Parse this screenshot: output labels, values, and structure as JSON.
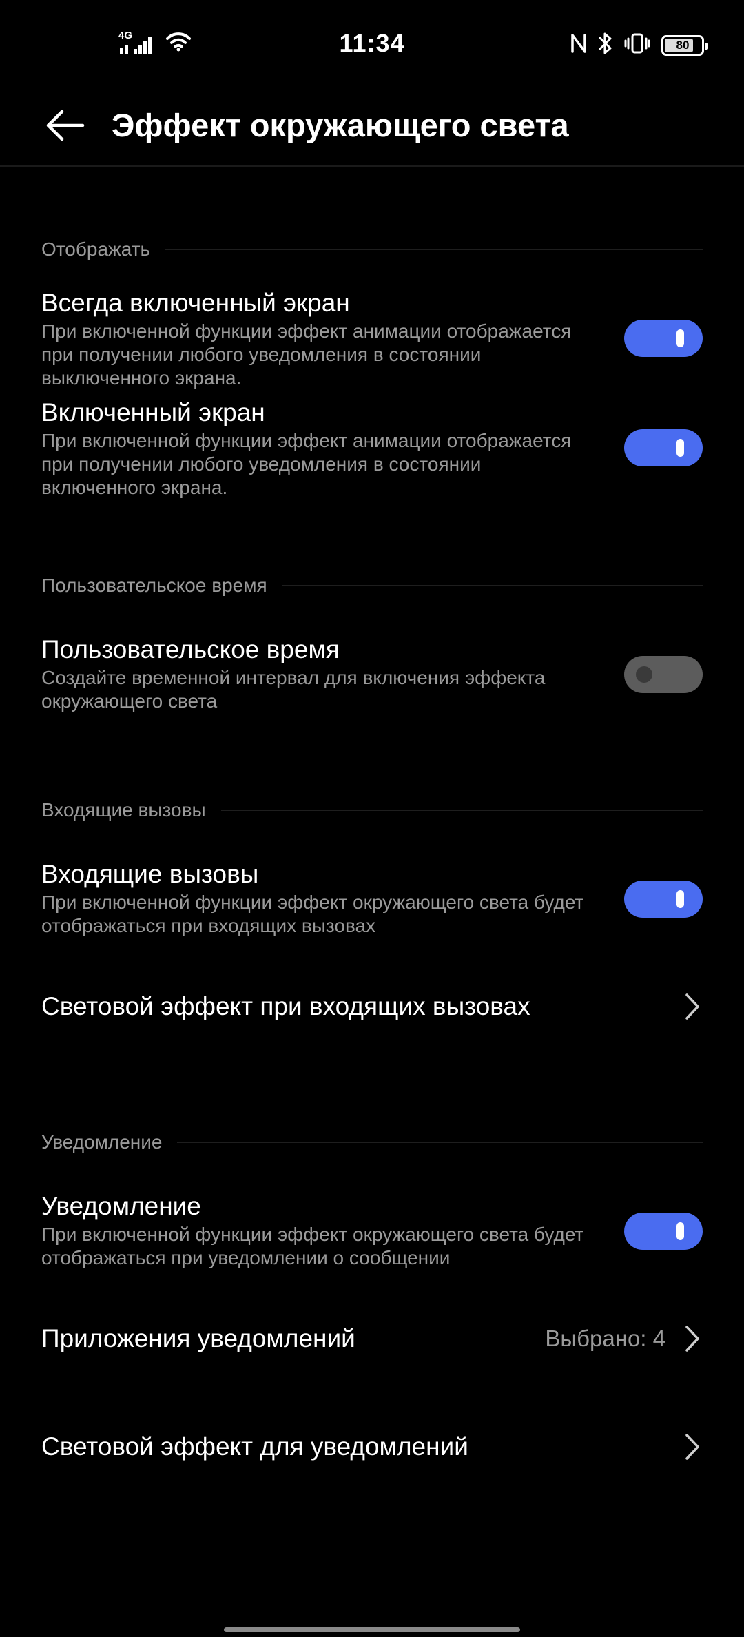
{
  "status_bar": {
    "network": "4G",
    "time": "11:34",
    "battery": "80",
    "battery_fraction": 0.8
  },
  "header": {
    "title": "Эффект окружающего света"
  },
  "sections": {
    "display": {
      "label": "Отображать",
      "always_on": {
        "title": "Всегда включенный экран",
        "description": "При включенной функции эффект анимации отображается при получении любого уведомления в состоянии выключенного экрана.",
        "enabled": true
      },
      "screen_on": {
        "title": "Включенный экран",
        "description": "При включенной функции эффект анимации отображается при получении любого уведомления в состоянии включенного экрана.",
        "enabled": true
      }
    },
    "custom_time": {
      "label": "Пользовательское время",
      "setting": {
        "title": "Пользовательское время",
        "description": "Создайте временной интервал для включения эффекта окружающего света",
        "enabled": false
      }
    },
    "incoming_calls": {
      "label": "Входящие вызовы",
      "setting": {
        "title": "Входящие вызовы",
        "description": "При включенной функции эффект окружающего света будет отображаться при входящих вызовах",
        "enabled": true
      },
      "light_effect": {
        "title": "Световой эффект при входящих вызовах"
      }
    },
    "notifications": {
      "label": "Уведомление",
      "setting": {
        "title": "Уведомление",
        "description": "При включенной функции эффект окружающего света будет отображаться при уведомлении о сообщении",
        "enabled": true
      },
      "apps": {
        "title": "Приложения уведомлений",
        "value": "Выбрано: 4"
      },
      "light_effect": {
        "title": "Световой эффект для уведомлений"
      }
    }
  },
  "colors": {
    "accent": "#4a6cf0",
    "background": "#000000",
    "secondary_text": "#9a9a9a",
    "toggle_off": "#5c5c5c"
  }
}
